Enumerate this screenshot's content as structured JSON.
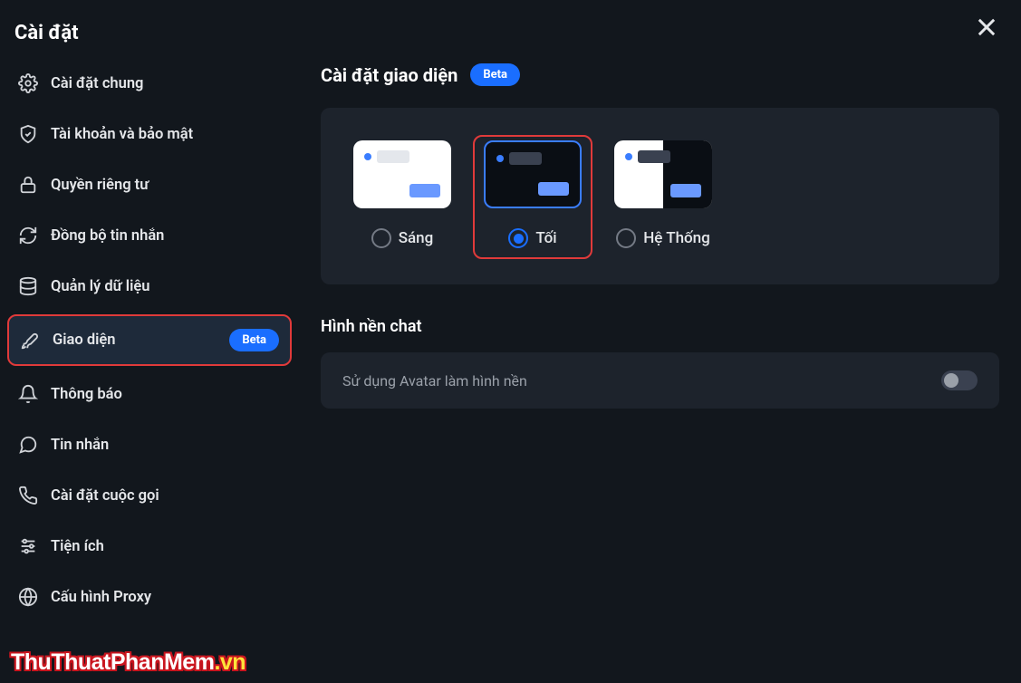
{
  "sidebar": {
    "title": "Cài đặt",
    "items": [
      {
        "label": "Cài đặt chung",
        "icon": "gear"
      },
      {
        "label": "Tài khoản và bảo mật",
        "icon": "shield"
      },
      {
        "label": "Quyền riêng tư",
        "icon": "lock"
      },
      {
        "label": "Đồng bộ tin nhắn",
        "icon": "sync"
      },
      {
        "label": "Quản lý dữ liệu",
        "icon": "database"
      },
      {
        "label": "Giao diện",
        "icon": "brush",
        "badge": "Beta",
        "active": true
      },
      {
        "label": "Thông báo",
        "icon": "bell"
      },
      {
        "label": "Tin nhắn",
        "icon": "chat"
      },
      {
        "label": "Cài đặt cuộc gọi",
        "icon": "phone"
      },
      {
        "label": "Tiện ích",
        "icon": "sliders"
      },
      {
        "label": "Cấu hình Proxy",
        "icon": "globe"
      }
    ]
  },
  "main": {
    "section_title": "Cài đặt giao diện",
    "section_badge": "Beta",
    "themes": [
      {
        "label": "Sáng",
        "value": "light",
        "selected": false
      },
      {
        "label": "Tối",
        "value": "dark",
        "selected": true
      },
      {
        "label": "Hệ Thống",
        "value": "system",
        "selected": false
      }
    ],
    "chat_bg_title": "Hình nền chat",
    "avatar_bg_label": "Sử dụng Avatar làm hình nền",
    "avatar_bg_enabled": false
  },
  "watermark": {
    "main": "ThuThuatPhanMem",
    "suffix": ".vn"
  }
}
